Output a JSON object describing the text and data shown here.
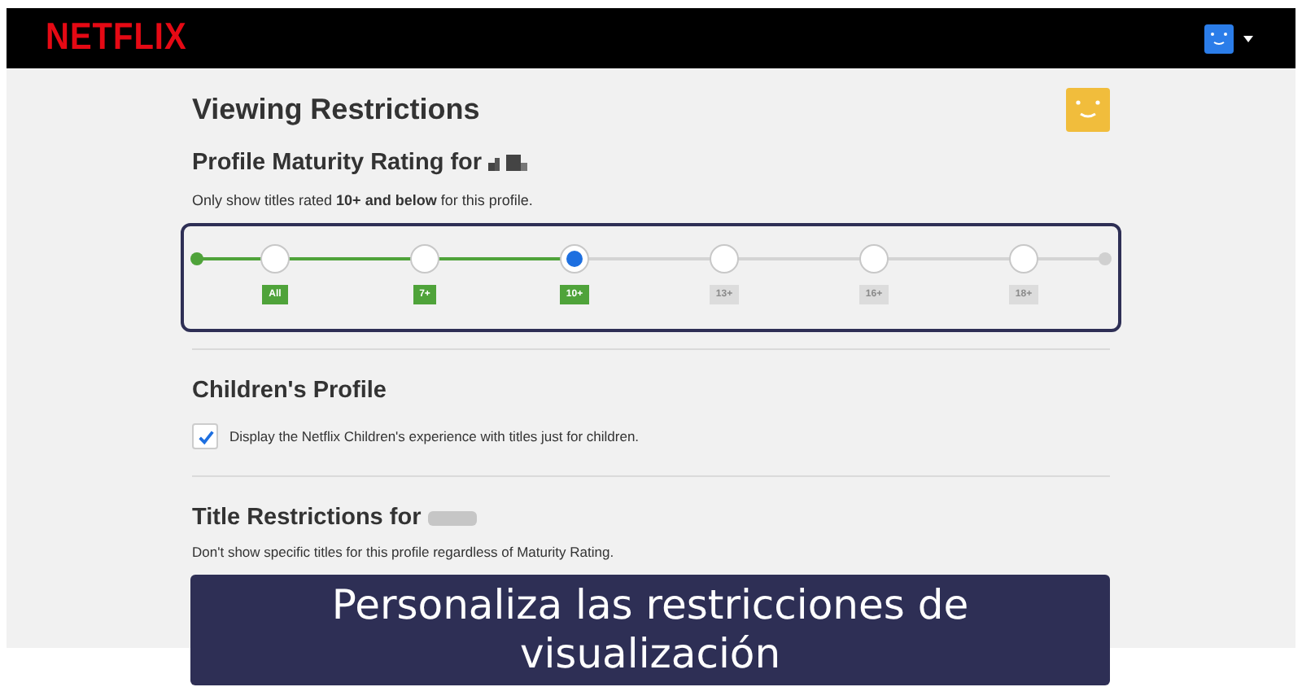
{
  "header": {
    "logo": "NETFLIX"
  },
  "page": {
    "title": "Viewing Restrictions"
  },
  "maturity": {
    "heading": "Profile Maturity Rating for",
    "description": "Only show titles rated **10+ and below** for this profile.",
    "ratings": [
      {
        "label": "All",
        "selected": false
      },
      {
        "label": "7+",
        "selected": false
      },
      {
        "label": "10+",
        "selected": true
      },
      {
        "label": "13+",
        "selected": false
      },
      {
        "label": "16+",
        "selected": false
      },
      {
        "label": "18+",
        "selected": false
      }
    ]
  },
  "children_profile": {
    "heading": "Children's Profile",
    "checkbox": {
      "label": "Display the Netflix Children's experience with titles just for children.",
      "checked": true
    }
  },
  "title_restrictions": {
    "heading": "Title Restrictions for",
    "description": "Don't show specific titles for this profile regardless of Maturity Rating."
  },
  "caption": "Personaliza las restricciones de visualización"
}
